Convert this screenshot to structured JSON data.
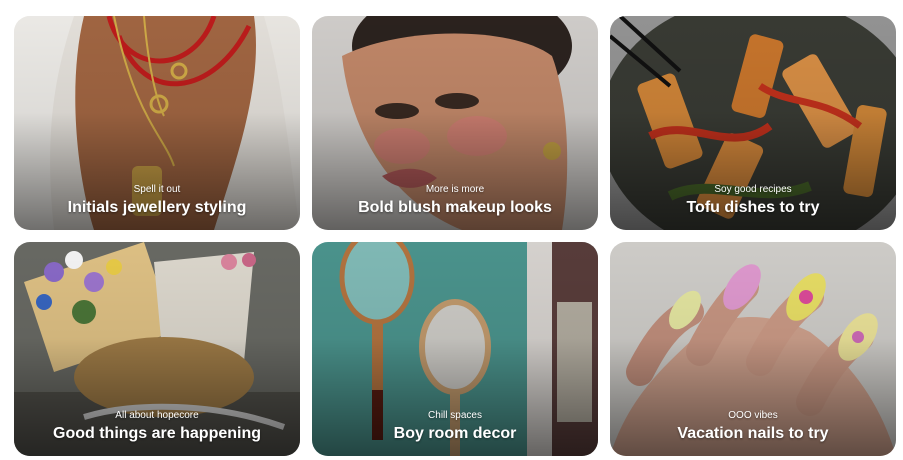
{
  "cards": [
    {
      "subtitle": "Spell it out",
      "title": "Initials jewellery styling",
      "image": "gold-necklaces-on-white-shirt"
    },
    {
      "subtitle": "More is more",
      "title": "Bold blush makeup looks",
      "image": "woman-portrait-blush-makeup"
    },
    {
      "subtitle": "Soy good recipes",
      "title": "Tofu dishes to try",
      "image": "tofu-stir-fry-plate"
    },
    {
      "subtitle": "All about hopecore",
      "title": "Good things are happening",
      "image": "bicycle-basket-flowers"
    },
    {
      "subtitle": "Chill spaces",
      "title": "Boy room decor",
      "image": "wooden-racket-mirrors-teal-wall"
    },
    {
      "subtitle": "OOO vibes",
      "title": "Vacation nails to try",
      "image": "pastel-pink-yellow-manicure"
    }
  ]
}
